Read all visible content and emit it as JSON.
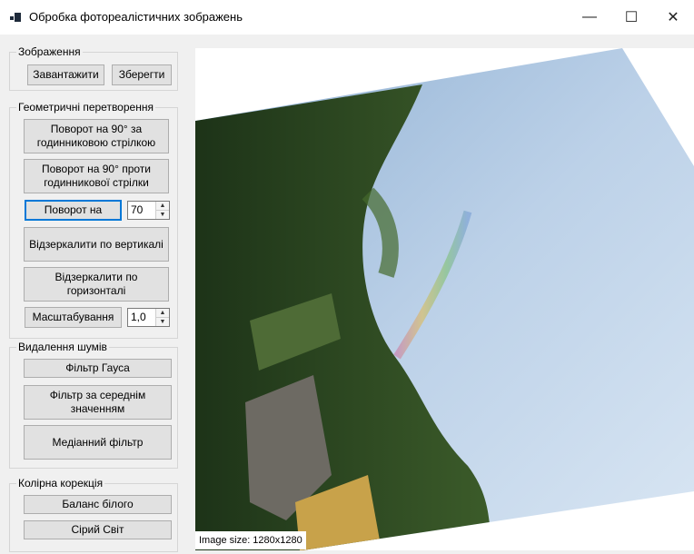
{
  "window": {
    "title": "Обробка фотореалістичних зображень",
    "minimize_glyph": "—",
    "maximize_glyph": "☐",
    "close_glyph": "✕"
  },
  "image_group": {
    "label": "Зображення",
    "load_label": "Завантажити",
    "save_label": "Зберегти"
  },
  "geometry_group": {
    "label": "Геометричні перетворення",
    "rotate_cw_label": "Поворот на 90° за годинниковою стрілкою",
    "rotate_ccw_label": "Поворот на 90° проти годинникової стрілки",
    "rotate_label": "Поворот на",
    "rotate_value": "70",
    "mirror_vertical_label": "Відзеркалити по вертикалі",
    "mirror_horizontal_label": "Відзеркалити по горизонталі",
    "scale_label": "Масштабування",
    "scale_value": "1,0"
  },
  "noise_group": {
    "label": "Видалення шумів",
    "gauss_label": "Фільтр Гауса",
    "mean_label": "Фільтр за середнім значенням",
    "median_label": "Медіанний фільтр"
  },
  "color_group": {
    "label": "Колірна корекція",
    "white_balance_label": "Баланс білого",
    "gray_world_label": "Сірий Світ"
  },
  "status": {
    "image_size": "Image size: 1280x1280"
  },
  "colors": {
    "accent": "#0078d7",
    "sky": "#b9cfe6",
    "foliage": "#2f4a22"
  },
  "icons": {
    "app": "app-icon",
    "spin_up": "spin-up-icon",
    "spin_down": "spin-down-icon"
  }
}
